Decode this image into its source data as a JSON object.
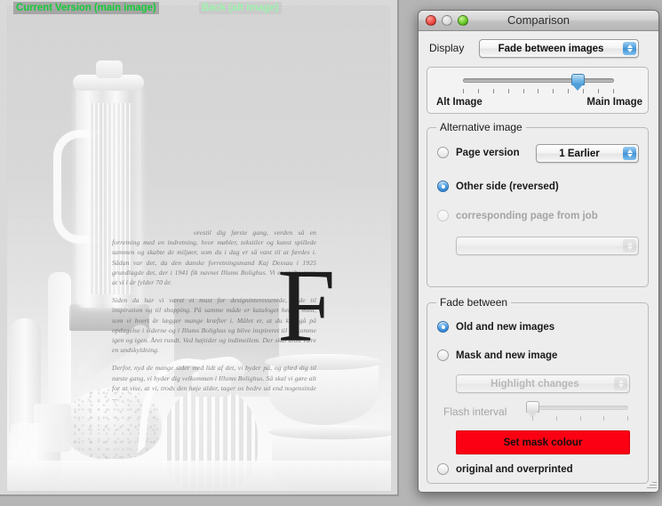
{
  "viewer": {
    "badge_main": "Current Version (main image)",
    "badge_alt": "Back (alt image)",
    "badge_main_color": "#19c93a",
    "badge_alt_color": "#9ef2ad",
    "document": {
      "dropcap": "F",
      "paragraph_1": "orestil dig første gang, verden så en forretning med en indretning, hvor møbler, tekstiler og kunst spillede sammen og skabte de miljøer, som du i dag er så vant til at færdes i. Sådan var det, da den danske forretningsmand Kaj Dessau i 1925 grundlagde det, der i 1941 fik navnet Illums Bolighus. Vi er stolte over, at vi i år fylder 70 år.",
      "paragraph_2": "Siden da har vi været et must for designinteresserede, både til inspiration og til shopping. På samme måde er kataloget her et must, som vi hvert år lægger mange kræfter i. Målet er, at du kan gå på opdagelse i siderne og i Illums Bolighus og blive inspireret til at komme igen og igen. Året rundt. Ved højtider og indimellem. Der skal altid være en undskyldning.",
      "paragraph_3": "Derfor, nyd de mange sider med lidt af det, vi byder på, og glæd dig til næste gang, vi byder dig velkommen i Illums Bolighus. Så skal vi gøre alt for at vise, at vi, trods den høje alder, tager os bedre ud end nogensinde ..."
    }
  },
  "dialog": {
    "title": "Comparison",
    "traffic_lights": {
      "close": "close-button",
      "minimize": "minimize-button",
      "zoom": "zoom-button"
    },
    "display": {
      "label": "Display",
      "value": "Fade between images"
    },
    "fade_slider": {
      "left_label": "Alt Image",
      "right_label": "Main Image",
      "ticks": 11,
      "position_percent": 76
    },
    "alternative_image": {
      "group_title": "Alternative image",
      "page_version": {
        "label": "Page version",
        "selected": false,
        "popup_value": "1 Earlier"
      },
      "other_side": {
        "label": "Other side (reversed)",
        "selected": true
      },
      "corresponding_page": {
        "label": "corresponding page from job",
        "selected": false,
        "disabled": true
      },
      "job_popup": {
        "value": "",
        "disabled": true
      }
    },
    "fade_between": {
      "group_title": "Fade between",
      "old_and_new": {
        "label": "Old and new images",
        "selected": true
      },
      "mask_and_new": {
        "label": "Mask and new image",
        "selected": false
      },
      "highlight_popup": {
        "value": "Highlight changes",
        "disabled": true
      },
      "flash_interval": {
        "label": "Flash interval",
        "ticks": 5,
        "position_percent": 0,
        "disabled": true
      },
      "mask_colour_button": {
        "label": "Set mask colour",
        "color": "#fb0012"
      },
      "original_overprinted": {
        "label": "original and overprinted",
        "selected": false
      }
    }
  }
}
